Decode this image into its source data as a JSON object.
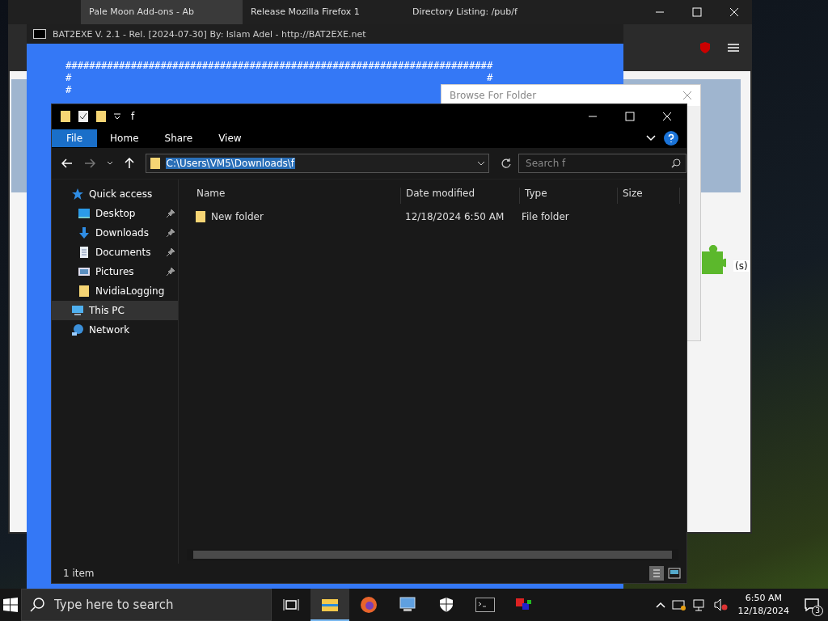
{
  "browser": {
    "tabs": [
      {
        "title": "Pale Moon Add-ons - Ab",
        "selected": true
      },
      {
        "title": "Release Mozilla Firefox 1",
        "selected": false
      },
      {
        "title": "Directory Listing: /pub/f",
        "selected": false
      }
    ],
    "side_text": "(s)"
  },
  "console": {
    "title": "BAT2EXE V. 2.1 - Rel. [2024-07-30] By: Islam Adel - http://BAT2EXE.net",
    "lines": [
      "########################################################################",
      "#                                                                      #",
      "#"
    ]
  },
  "browse_dialog": {
    "title": "Browse For Folder"
  },
  "explorer": {
    "title": "f",
    "ribbon_tabs": [
      {
        "label": "File",
        "selected": true
      },
      {
        "label": "Home",
        "selected": false
      },
      {
        "label": "Share",
        "selected": false
      },
      {
        "label": "View",
        "selected": false
      }
    ],
    "address": "C:\\Users\\VM5\\Downloads\\f",
    "search": {
      "placeholder": "Search f"
    },
    "nav": [
      {
        "label": "Quick access",
        "kind": "star",
        "selected": false,
        "children": [
          {
            "label": "Desktop",
            "kind": "desktop",
            "pinned": true,
            "selected": false
          },
          {
            "label": "Downloads",
            "kind": "download",
            "pinned": true,
            "selected": false
          },
          {
            "label": "Documents",
            "kind": "document",
            "pinned": true,
            "selected": false
          },
          {
            "label": "Pictures",
            "kind": "picture",
            "pinned": true,
            "selected": false
          },
          {
            "label": "NvidiaLogging",
            "kind": "folder",
            "pinned": false,
            "selected": false
          }
        ]
      },
      {
        "label": "This PC",
        "kind": "pc",
        "selected": true
      },
      {
        "label": "Network",
        "kind": "network",
        "selected": false
      }
    ],
    "columns": [
      "Name",
      "Date modified",
      "Type",
      "Size"
    ],
    "rows": [
      {
        "name": "New folder",
        "date": "12/18/2024 6:50 AM",
        "type": "File folder",
        "size": ""
      }
    ],
    "status": "1 item"
  },
  "taskbar": {
    "search": {
      "placeholder": "Type here to search"
    },
    "apps": [
      {
        "kind": "taskview",
        "active": false
      },
      {
        "kind": "explorer",
        "active": true
      },
      {
        "kind": "firefox",
        "active": false
      },
      {
        "kind": "monitor",
        "active": false
      },
      {
        "kind": "shield",
        "active": false
      },
      {
        "kind": "console",
        "active": false
      },
      {
        "kind": "paint",
        "active": false
      }
    ],
    "time": "6:50 AM",
    "date": "12/18/2024",
    "notifications": "3"
  }
}
